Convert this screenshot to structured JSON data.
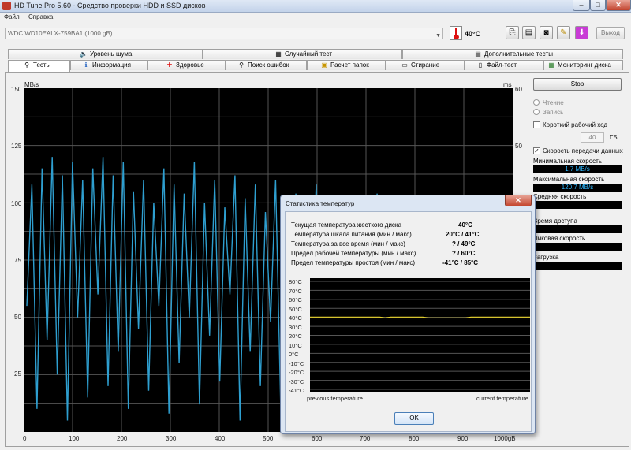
{
  "window": {
    "title": "HD Tune Pro 5.60 - Средство проверки HDD  и SSD дисков",
    "minimize": "–",
    "maximize": "□",
    "close": "✕"
  },
  "menu": [
    "Файл",
    "Справка"
  ],
  "toolbar": {
    "drive": "WDC WD10EALX-759BA1 (1000 gB)",
    "temperature": "40°C",
    "exit_label": "Выход",
    "icons": [
      "copy-icon",
      "paste-icon",
      "camera-icon",
      "tools-icon",
      "download-icon"
    ]
  },
  "tabs_top": [
    {
      "label": "Уровень шума",
      "icon": "speaker-icon",
      "glyph": "🔈"
    },
    {
      "label": "Случайный тест",
      "icon": "random-test-icon",
      "glyph": "▦"
    },
    {
      "label": "Дополнительные тесты",
      "icon": "extra-tests-icon",
      "glyph": "▤"
    }
  ],
  "tabs_bottom": [
    {
      "label": "Тесты",
      "icon": "benchmark-icon",
      "glyph": "⚲"
    },
    {
      "label": "Информация",
      "icon": "info-icon",
      "glyph": "ℹ"
    },
    {
      "label": "Здоровье",
      "icon": "health-icon",
      "glyph": "✚"
    },
    {
      "label": "Поиск ошибок",
      "icon": "error-scan-icon",
      "glyph": "⚲"
    },
    {
      "label": "Расчет папок",
      "icon": "folder-icon",
      "glyph": "▣"
    },
    {
      "label": "Стирание",
      "icon": "erase-icon",
      "glyph": "▭"
    },
    {
      "label": "Файл-тест",
      "icon": "file-test-icon",
      "glyph": "▯"
    },
    {
      "label": "Мониторинг диска",
      "icon": "monitor-icon",
      "glyph": "▦"
    }
  ],
  "benchmark": {
    "left_unit": "MB/s",
    "right_unit": "ms",
    "left_ticks": [
      "150",
      "125",
      "100",
      "75",
      "50",
      "25"
    ],
    "right_ticks": [
      "60",
      "50"
    ],
    "x_ticks": [
      "0",
      "100",
      "200",
      "300",
      "400",
      "500",
      "600",
      "700",
      "800",
      "900",
      "1000gB"
    ]
  },
  "chart_data": {
    "type": "line",
    "series": [
      {
        "values": [
          55,
          108,
          10,
          115,
          40,
          120,
          25,
          112,
          5,
          118,
          50,
          110,
          15,
          115,
          60,
          120,
          20,
          112,
          35,
          118,
          10,
          105,
          45,
          110,
          18,
          100,
          55,
          115,
          8,
          108,
          30,
          104,
          50,
          118,
          12,
          100,
          42,
          110,
          22,
          98,
          60,
          112,
          5,
          102,
          35,
          108,
          20,
          96,
          48,
          110,
          12,
          100,
          40,
          104,
          28,
          92,
          50,
          108,
          15,
          96,
          42,
          102,
          8,
          94,
          35,
          100,
          22,
          90,
          48,
          104,
          10,
          92,
          30,
          98,
          45,
          88,
          18,
          96,
          40,
          100,
          12,
          90,
          50,
          98,
          25,
          86,
          42,
          94
        ]
      }
    ],
    "x_range": [
      0,
      1000
    ],
    "ylim": [
      0,
      150
    ],
    "grid": true
  },
  "controls": {
    "stop_label": "Stop",
    "read_label": "Чтение",
    "write_label": "Запись",
    "short_stroke_label": "Короткий рабочий ход",
    "short_stroke_value": "40",
    "short_stroke_unit": "ГБ",
    "transfer_rate_label": "Скорость передачи данных",
    "transfer_rate_checked": "✓",
    "min_speed_label": "Минимальная скорость",
    "min_speed_value": "1.7 MB/s",
    "max_speed_label": "Максимальная скорость",
    "max_speed_value": "120.7 MB/s",
    "avg_speed_label": "Средняя скорость",
    "access_time_label": "Время доступа",
    "burst_rate_label": "Пиковая скорость",
    "cpu_usage_label": "Загрузка"
  },
  "dialog": {
    "title": "Статистика температур",
    "close": "✕",
    "rows": [
      {
        "label": "Текущая температура жесткого диска",
        "value": "40°C"
      },
      {
        "label": "Температура шкала питания (мин / макс)",
        "value": "20°C / 41°C"
      },
      {
        "label": "Температура за все время (мин / макс)",
        "value": "? / 49°C"
      },
      {
        "label": "Предел рабочей температуры (мин / макс)",
        "value": "? / 60°C"
      },
      {
        "label": "Предел температуры простоя (мин / макс)",
        "value": "-41°C / 85°C"
      }
    ],
    "y_ticks": [
      "80°C",
      "70°C",
      "60°C",
      "50°C",
      "40°C",
      "30°C",
      "20°C",
      "10°C",
      "0°C",
      "-10°C",
      "-20°C",
      "-30°C",
      "-41°C"
    ],
    "legend_left": "previous temperature",
    "legend_right": "current temperature",
    "ok_label": "OK",
    "temp_values": [
      40,
      40,
      40,
      40,
      40,
      40,
      40,
      40,
      40,
      40,
      40,
      40,
      40,
      40,
      39,
      40,
      40,
      40,
      40,
      40,
      40,
      40,
      39,
      39,
      39,
      39,
      39,
      39,
      39,
      39,
      40,
      40,
      40,
      40,
      40,
      40,
      40,
      40,
      40,
      40,
      40,
      40
    ]
  }
}
